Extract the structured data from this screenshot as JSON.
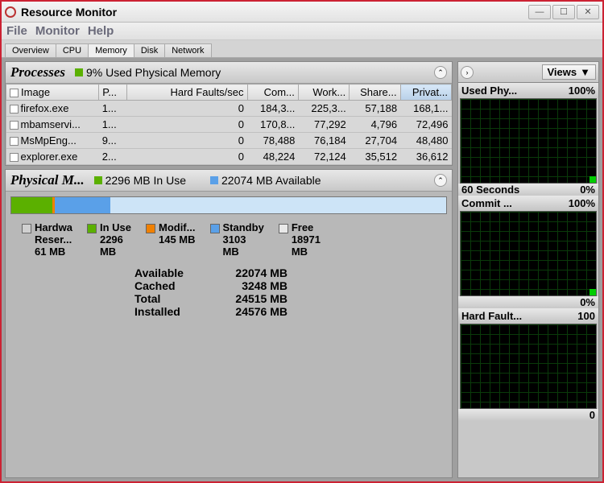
{
  "window": {
    "title": "Resource Monitor"
  },
  "menu": {
    "file": "File",
    "monitor": "Monitor",
    "help": "Help"
  },
  "tabs": [
    "Overview",
    "CPU",
    "Memory",
    "Disk",
    "Network"
  ],
  "processes": {
    "title": "Processes",
    "header_pct": "9% Used Physical Memory",
    "columns": [
      "Image",
      "P...",
      "Hard Faults/sec",
      "Com...",
      "Work...",
      "Share...",
      "Privat..."
    ],
    "rows": [
      {
        "image": "firefox.exe",
        "pid": "1...",
        "hf": "0",
        "com": "184,3...",
        "work": "225,3...",
        "share": "57,188",
        "priv": "168,1..."
      },
      {
        "image": "mbamservi...",
        "pid": "1...",
        "hf": "0",
        "com": "170,8...",
        "work": "77,292",
        "share": "4,796",
        "priv": "72,496"
      },
      {
        "image": "MsMpEng...",
        "pid": "9...",
        "hf": "0",
        "com": "78,488",
        "work": "76,184",
        "share": "27,704",
        "priv": "48,480"
      },
      {
        "image": "explorer.exe",
        "pid": "2...",
        "hf": "0",
        "com": "48,224",
        "work": "72,124",
        "share": "35,512",
        "priv": "36,612"
      }
    ]
  },
  "physical": {
    "title": "Physical M...",
    "in_use_hdr": "2296 MB In Use",
    "avail_hdr": "22074 MB Available",
    "legend": {
      "hw": {
        "l1": "Hardwa",
        "l2": "Reser...",
        "l3": "61 MB"
      },
      "inuse": {
        "l1": "In Use",
        "l2": "2296",
        "l3": "MB"
      },
      "mod": {
        "l1": "Modif...",
        "l2": "145 MB"
      },
      "standby": {
        "l1": "Standby",
        "l2": "3103",
        "l3": "MB"
      },
      "free": {
        "l1": "Free",
        "l2": "18971",
        "l3": "MB"
      }
    },
    "stats": {
      "available": {
        "label": "Available",
        "value": "22074 MB"
      },
      "cached": {
        "label": "Cached",
        "value": "3248 MB"
      },
      "total": {
        "label": "Total",
        "value": "24515 MB"
      },
      "installed": {
        "label": "Installed",
        "value": "24576 MB"
      }
    }
  },
  "right": {
    "views": "Views",
    "g1": {
      "title": "Used Phy...",
      "top": "100%",
      "bl": "60 Seconds",
      "br": "0%"
    },
    "g2": {
      "title": "Commit ...",
      "top": "100%",
      "br": "0%"
    },
    "g3": {
      "title": "Hard Fault...",
      "top": "100",
      "br": "0"
    }
  },
  "colors": {
    "green": "#5bb000",
    "orange": "#f08000",
    "blue": "#5aa0e8",
    "gray": "#d0d0d0"
  }
}
